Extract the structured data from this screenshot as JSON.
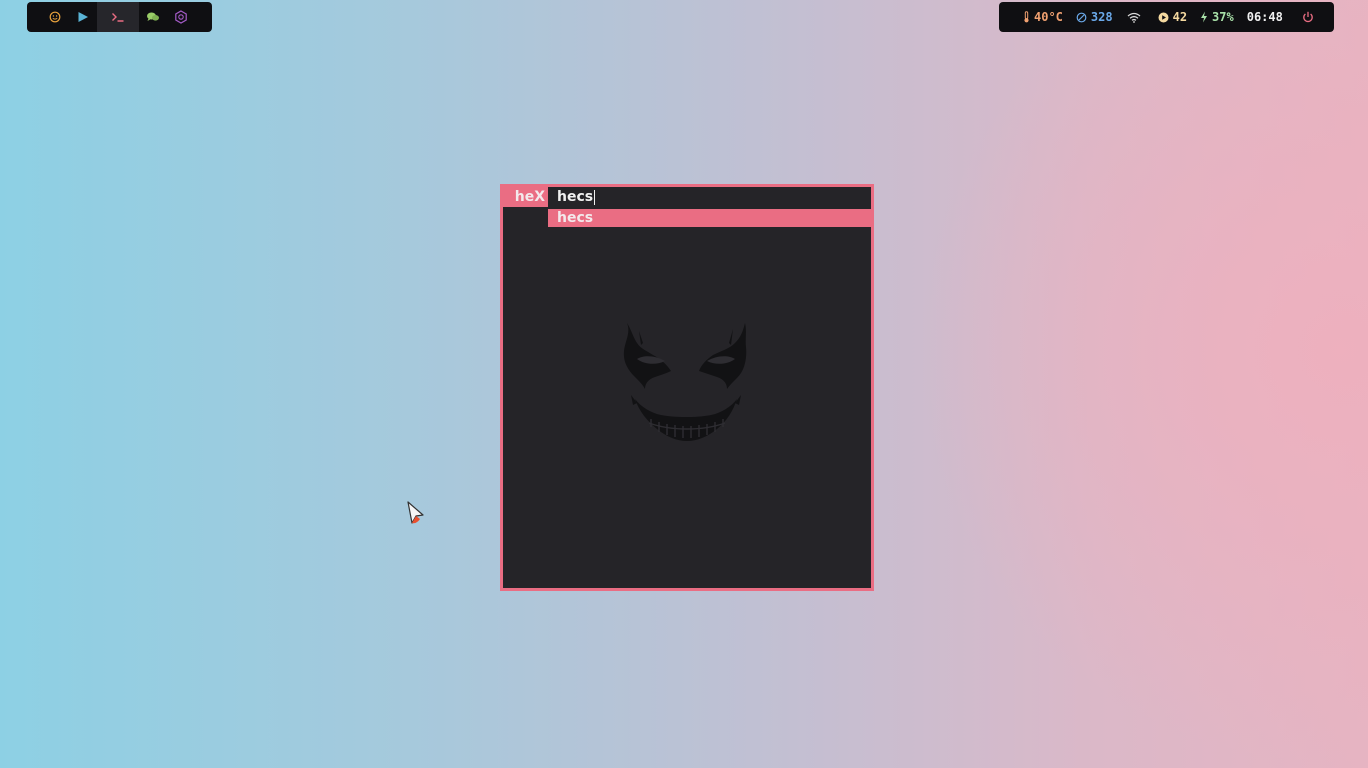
{
  "dock": {
    "items": [
      {
        "icon": "emoji-face-icon",
        "color": "#e8a23d"
      },
      {
        "icon": "play-triangle-icon",
        "color": "#5ab4d6"
      },
      {
        "icon": "terminal-icon",
        "color": "#ea6d83",
        "active": true
      },
      {
        "icon": "chat-bubbles-icon",
        "color": "#9acd68"
      },
      {
        "icon": "hexagon-gear-icon",
        "color": "#a45bc8"
      }
    ]
  },
  "status": {
    "temperature": "40°C",
    "updates": "328",
    "volume": "42",
    "battery": "37%",
    "clock": "06:48",
    "colors": {
      "temperature": "#f0a070",
      "updates": "#6aa8e8",
      "wifi": "#d8d8d8",
      "volume": "#f4d9a0",
      "battery": "#a8e0a8",
      "clock": "#f0f0f0",
      "power": "#ea6d83"
    }
  },
  "launcher": {
    "prompt": "heX",
    "input_value": "hecs",
    "results": [
      "hecs"
    ],
    "accent": "#ea6d83",
    "background": "#252428"
  }
}
